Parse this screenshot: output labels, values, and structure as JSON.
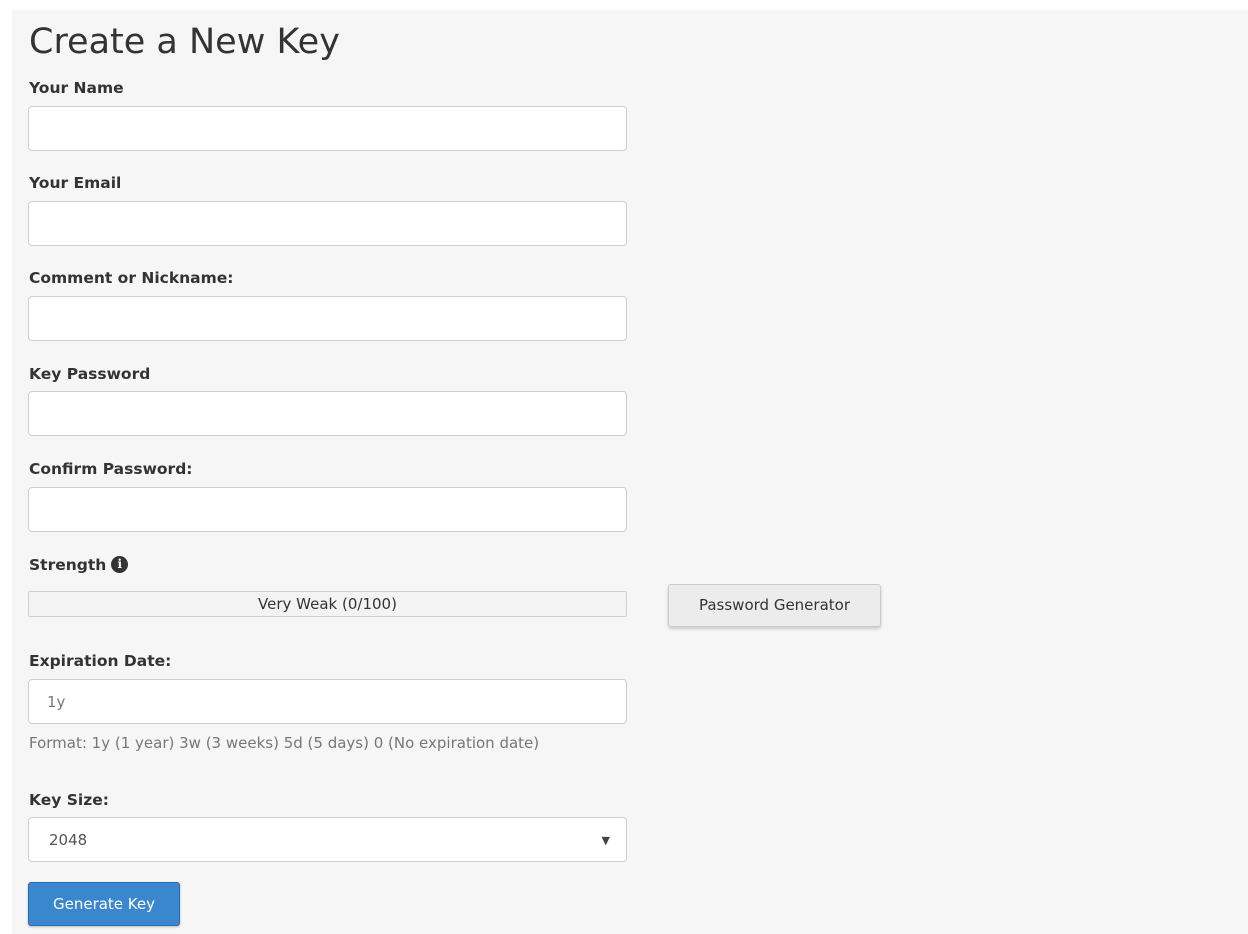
{
  "page": {
    "title": "Create a New Key"
  },
  "form": {
    "name": {
      "label": "Your Name",
      "value": ""
    },
    "email": {
      "label": "Your Email",
      "value": ""
    },
    "comment": {
      "label": "Comment or Nickname:",
      "value": ""
    },
    "password": {
      "label": "Key Password",
      "value": ""
    },
    "confirm_password": {
      "label": "Confirm Password:",
      "value": ""
    },
    "strength": {
      "label": "Strength",
      "info_icon": "info-circle-icon",
      "meter_text": "Very Weak (0/100)",
      "score": 0,
      "max": 100,
      "bar_color": "#c9302c"
    },
    "password_generator_label": "Password Generator",
    "expiration": {
      "label": "Expiration Date:",
      "value": "1y",
      "help": "Format: 1y (1 year) 3w (3 weeks) 5d (5 days) 0 (No expiration date)"
    },
    "key_size": {
      "label": "Key Size:",
      "selected": "2048",
      "arrow_icon": "caret-down-icon"
    },
    "submit_label": "Generate Key"
  },
  "colors": {
    "panel_background": "#f6f6f6",
    "primary_button": "#3a87d0",
    "text": "#333333",
    "muted_text": "#777777"
  }
}
